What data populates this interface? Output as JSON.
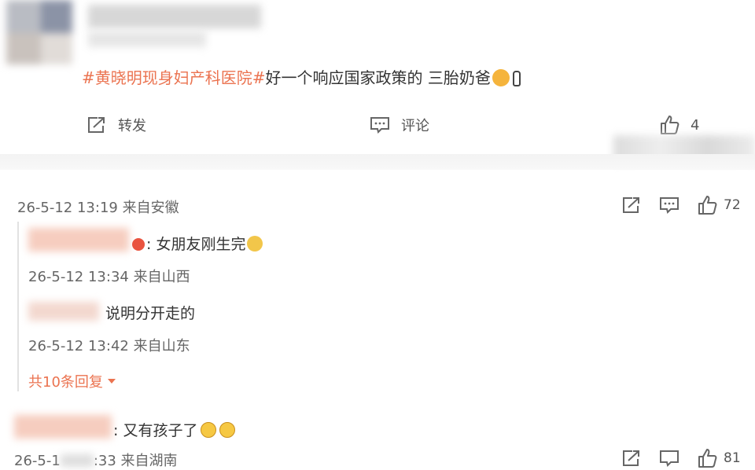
{
  "post": {
    "hashtag": "#黄晓明现身妇产科医院#",
    "text": "好一个响应国家政策的 三胎奶爸",
    "actions": {
      "repost": "转发",
      "comment": "评论",
      "like_count": "4"
    }
  },
  "comment1": {
    "timestamp": "26-5-12 13:19 来自安徽",
    "like_count": "72",
    "replies": [
      {
        "text": ": 女朋友刚生完",
        "timestamp": "26-5-12 13:34 来自山西"
      },
      {
        "text": "说明分开走的",
        "timestamp": "26-5-12 13:42 来自山东"
      }
    ],
    "more_replies": "共10条回复"
  },
  "comment2": {
    "text": ": 又有孩子了",
    "timestamp_start": "26-5-1",
    "timestamp_end": ":33 来自湖南",
    "like_count": "81"
  },
  "colors": {
    "accent": "#eb7350",
    "text": "#333333",
    "muted": "#666666"
  },
  "icons": [
    "repost-icon",
    "comment-icon",
    "like-icon",
    "chevron-down-icon"
  ]
}
